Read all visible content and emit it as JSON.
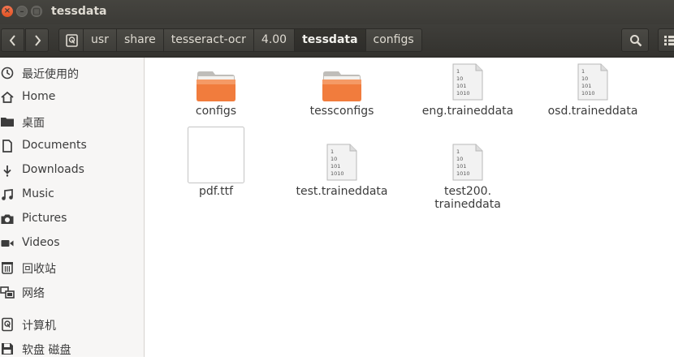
{
  "window": {
    "title": "tessdata",
    "close_glyph": "×",
    "minimize_glyph": "–",
    "maximize_glyph": "□"
  },
  "header": {
    "back_icon": "chevron-left-icon",
    "forward_icon": "chevron-right-icon",
    "breadcrumbs": [
      "usr",
      "share",
      "tesseract-ocr",
      "4.00",
      "tessdata",
      "configs"
    ],
    "active_crumb": "tessdata",
    "search_icon": "search-icon",
    "view_icon": "list-view-icon"
  },
  "sidebar": {
    "items": [
      {
        "label": "最近使用的",
        "icon": "recent-clock-icon"
      },
      {
        "label": "Home",
        "icon": "home-icon"
      },
      {
        "label": "桌面",
        "icon": "desktop-folder-icon"
      },
      {
        "label": "Documents",
        "icon": "document-icon"
      },
      {
        "label": "Downloads",
        "icon": "download-icon"
      },
      {
        "label": "Music",
        "icon": "music-icon"
      },
      {
        "label": "Pictures",
        "icon": "camera-icon"
      },
      {
        "label": "Videos",
        "icon": "video-icon"
      },
      {
        "label": "回收站",
        "icon": "trash-icon"
      },
      {
        "label": "网络",
        "icon": "network-icon"
      },
      {
        "label": "计算机",
        "icon": "computer-icon"
      },
      {
        "label": "软盘 磁盘",
        "icon": "floppy-icon"
      }
    ]
  },
  "files": [
    {
      "name": "configs",
      "type": "folder"
    },
    {
      "name": "tessconfigs",
      "type": "folder"
    },
    {
      "name": "eng.traineddata",
      "type": "binary"
    },
    {
      "name": "osd.traineddata",
      "type": "binary"
    },
    {
      "name": "pdf.ttf",
      "type": "font"
    },
    {
      "name": "test.traineddata",
      "type": "binary"
    },
    {
      "name": "test200.",
      "name_line2": "traineddata",
      "type": "binary"
    }
  ],
  "binary_icon_text": [
    "1",
    "10",
    "101",
    "1010"
  ],
  "colors": {
    "folder_orange": "#f17c3d",
    "titlebar_bg": "#3c3b37",
    "close_button": "#e95420",
    "sidebar_bg": "#f7f6f5"
  }
}
